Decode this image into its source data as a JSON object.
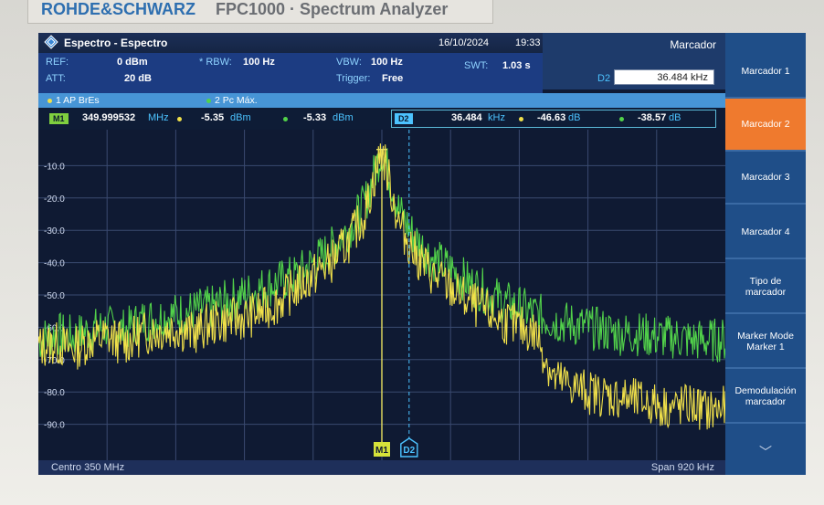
{
  "device": {
    "brand": "ROHDE&SCHWARZ",
    "model": "FPC1000 · Spectrum Analyzer"
  },
  "header": {
    "title": "Espectro - Espectro",
    "date": "16/10/2024",
    "time": "19:33",
    "marker_panel_title": "Marcador",
    "d2_label": "D2",
    "d2_value": "36.484 kHz"
  },
  "settings": {
    "ref_label": "REF:",
    "ref_value": "0 dBm",
    "att_label": "ATT:",
    "att_value": "20 dB",
    "rbw_label": "* RBW:",
    "rbw_value": "100 Hz",
    "vbw_label": "VBW:",
    "vbw_value": "100 Hz",
    "trigger_label": "Trigger:",
    "trigger_value": "Free",
    "swt_label": "SWT:",
    "swt_value": "1.03 s"
  },
  "traces": {
    "t1": "1 AP  BrEs",
    "t2": "2 Pc  Máx.",
    "t1_color": "#f0e04a",
    "t2_color": "#52d24a"
  },
  "markers": {
    "m1_tag": "M1",
    "m1_freq": "349.999532",
    "m1_freq_unit": "MHz",
    "m1_t1": "-5.35",
    "m1_t1_unit": "dBm",
    "m1_t2": "-5.33",
    "m1_t2_unit": "dBm",
    "d2_tag": "D2",
    "d2_freq": "36.484",
    "d2_freq_unit": "kHz",
    "d2_t1": "-46.63",
    "d2_t1_unit": "dB",
    "d2_t2": "-38.57",
    "d2_t2_unit": "dB"
  },
  "plot": {
    "ylabels": [
      "-10.0",
      "-20.0",
      "-30.0",
      "-40.0",
      "-50.0",
      "-60.0",
      "-70.0",
      "-80.0",
      "-90.0"
    ],
    "m1_flag": "M1",
    "d2_flag": "D2"
  },
  "footer": {
    "center": "Centro 350 MHz",
    "span": "Span 920 kHz"
  },
  "softkeys": [
    {
      "label": "Marcador 1",
      "active": false
    },
    {
      "label": "Marcador 2",
      "active": true
    },
    {
      "label": "Marcador 3",
      "active": false
    },
    {
      "label": "Marcador 4",
      "active": false
    },
    {
      "label": "Tipo de marcador",
      "active": false
    },
    {
      "label": "Marker Mode Marker 1",
      "active": false
    },
    {
      "label": "Demodulación marcador",
      "active": false
    },
    {
      "label": "",
      "icon": "chevron-down-icon",
      "active": false
    }
  ],
  "chart_data": {
    "type": "line",
    "x_center_mhz": 350,
    "x_span_khz": 920,
    "ylim": [
      -100,
      0
    ],
    "grid": true,
    "series": [
      {
        "name": "1 AP BrEs",
        "values": [
          -66,
          -65,
          -67,
          -64,
          -63,
          -65,
          -62,
          -61,
          -60,
          -62,
          -59,
          -58,
          -57,
          -55,
          -52,
          -48,
          -44,
          -40,
          -34,
          -25,
          -5,
          -28,
          -38,
          -44,
          -48,
          -52,
          -55,
          -58,
          -60,
          -62,
          -76,
          -78,
          -80,
          -81,
          -82,
          -83,
          -84,
          -85,
          -84,
          -86,
          -85
        ]
      },
      {
        "name": "2 Pc Máx.",
        "values": [
          -64,
          -62,
          -63,
          -61,
          -60,
          -61,
          -58,
          -57,
          -56,
          -55,
          -54,
          -52,
          -50,
          -48,
          -46,
          -44,
          -40,
          -36,
          -30,
          -22,
          -5,
          -24,
          -33,
          -39,
          -42,
          -46,
          -49,
          -52,
          -54,
          -56,
          -58,
          -59,
          -60,
          -61,
          -62,
          -62,
          -63,
          -63,
          -64,
          -64,
          -64
        ]
      }
    ]
  }
}
